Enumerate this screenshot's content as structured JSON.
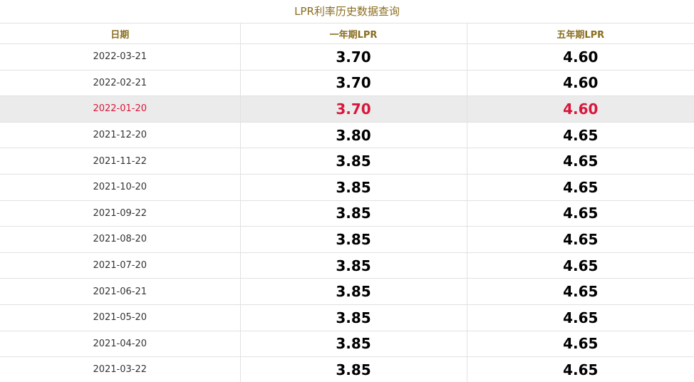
{
  "title": "LPR利率历史数据查询",
  "table": {
    "headers": [
      "日期",
      "一年期LPR",
      "五年期LPR"
    ],
    "highlight_color": "#d9163c",
    "rows": [
      {
        "date": "2022-03-21",
        "one_year": "3.70",
        "five_year": "4.60",
        "highlighted": false
      },
      {
        "date": "2022-02-21",
        "one_year": "3.70",
        "five_year": "4.60",
        "highlighted": false
      },
      {
        "date": "2022-01-20",
        "one_year": "3.70",
        "five_year": "4.60",
        "highlighted": true
      },
      {
        "date": "2021-12-20",
        "one_year": "3.80",
        "five_year": "4.65",
        "highlighted": false
      },
      {
        "date": "2021-11-22",
        "one_year": "3.85",
        "five_year": "4.65",
        "highlighted": false
      },
      {
        "date": "2021-10-20",
        "one_year": "3.85",
        "five_year": "4.65",
        "highlighted": false
      },
      {
        "date": "2021-09-22",
        "one_year": "3.85",
        "five_year": "4.65",
        "highlighted": false
      },
      {
        "date": "2021-08-20",
        "one_year": "3.85",
        "five_year": "4.65",
        "highlighted": false
      },
      {
        "date": "2021-07-20",
        "one_year": "3.85",
        "five_year": "4.65",
        "highlighted": false
      },
      {
        "date": "2021-06-21",
        "one_year": "3.85",
        "five_year": "4.65",
        "highlighted": false
      },
      {
        "date": "2021-05-20",
        "one_year": "3.85",
        "five_year": "4.65",
        "highlighted": false
      },
      {
        "date": "2021-04-20",
        "one_year": "3.85",
        "five_year": "4.65",
        "highlighted": false
      },
      {
        "date": "2021-03-22",
        "one_year": "3.85",
        "five_year": "4.65",
        "highlighted": false
      }
    ]
  }
}
